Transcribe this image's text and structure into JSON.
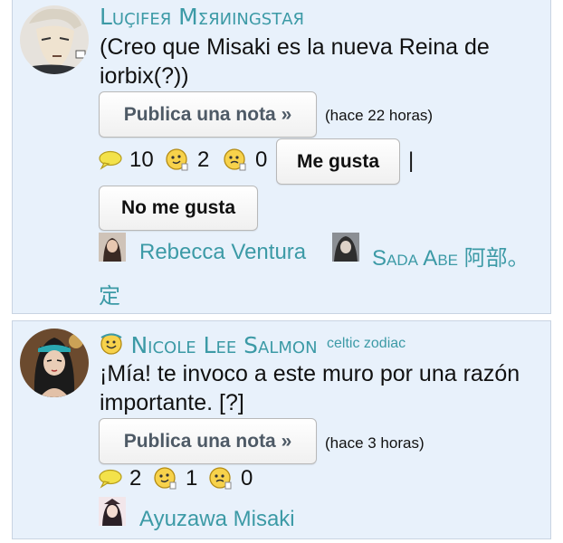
{
  "posts": [
    {
      "author": "Luçifeя Mσяиιngstαя",
      "text": "(Creo que Misaki es la nueva Reina de iorbix(?))",
      "publish_label": "Publica una nota »",
      "time": "(hace 22 horas)",
      "comments_count": "10",
      "likes_count": "2",
      "dislikes_count": "0",
      "like_button": "Me gusta",
      "separator": "|",
      "dislike_button": "No me gusta",
      "likers": [
        "Rebecca Ventura",
        "Sada Abe 阿部。",
        "定"
      ]
    },
    {
      "author": "Nicole Lee Salmon",
      "author_tag": "celtic zodiac",
      "text": "¡Mía! te invoco a este muro por una razón importante. [?]",
      "publish_label": "Publica una nota »",
      "time": "(hace 3 horas)",
      "comments_count": "2",
      "likes_count": "1",
      "dislikes_count": "0",
      "likers": [
        "Ayuzawa Misaki"
      ]
    }
  ],
  "colors": {
    "accent": "#3c9aa6",
    "card_bg": "#e8f1fb",
    "card_border": "#c9d4e2"
  },
  "icons": [
    "comment-bubble-icon",
    "like-smiley-icon",
    "dislike-smiley-icon",
    "zodiac-badge-icon"
  ]
}
